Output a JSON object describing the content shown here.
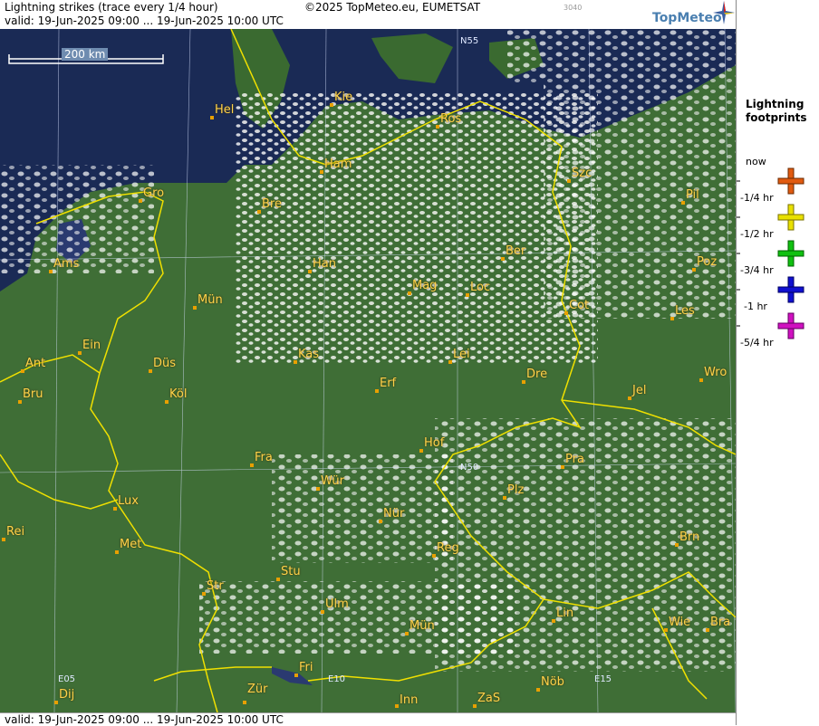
{
  "header": {
    "title": "Lightning strikes (trace every 1/4 hour)",
    "valid": "valid:  19-Jun-2025 09:00 ... 19-Jun-2025 10:00 UTC",
    "copyright": "©2025 TopMeteo.eu, EUMETSAT",
    "code": "3040",
    "logo": "TopMeteo"
  },
  "footer": {
    "valid": "valid:  19-Jun-2025 09:00 ... 19-Jun-2025 10:00 UTC"
  },
  "scale_bar": {
    "label": "200 km"
  },
  "legend": {
    "title": "Lightning footprints",
    "items": [
      {
        "label": "now",
        "color": "#e05a10"
      },
      {
        "label": "-1/4 hr",
        "color": "#e8e000"
      },
      {
        "label": "-1/2 hr",
        "color": "#10c010"
      },
      {
        "label": "-3/4 hr",
        "color": "#1010d0"
      },
      {
        "label": "-1 hr",
        "color": "#d010c0"
      },
      {
        "label": "-5/4 hr"
      }
    ]
  },
  "grid_labels": [
    "N55",
    "N50",
    "E05",
    "E10",
    "E15"
  ],
  "cities": [
    "Hel",
    "Kie",
    "Ros",
    "Ham",
    "Szc",
    "Gro",
    "Bre",
    "Pil",
    "Ber",
    "Ams",
    "Han",
    "Poz",
    "Mag",
    "Loc",
    "Mün",
    "Cot",
    "Les",
    "Ein",
    "Kas",
    "Lei",
    "Ant",
    "Düs",
    "Wro",
    "Dre",
    "Erf",
    "Bru",
    "Köl",
    "Jel",
    "Hof",
    "Fra",
    "Pra",
    "Lux",
    "Wür",
    "Plz",
    "Nür",
    "Rei",
    "Met",
    "Reg",
    "Brn",
    "Stu",
    "Str",
    "Ulm",
    "Lin",
    "Mün",
    "Wie",
    "Bra",
    "Fri",
    "Zür",
    "Dij",
    "Inn",
    "ZaS",
    "Nöb"
  ],
  "colors": {
    "sea": "#1a2a55",
    "land": "#3f6e36",
    "border": "#f0e000",
    "city_text": "#ffd24a"
  }
}
